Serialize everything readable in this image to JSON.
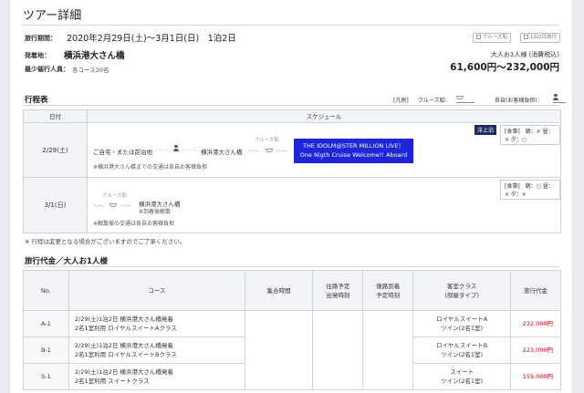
{
  "header": {
    "title": "ツアー詳細"
  },
  "info": {
    "period_label": "旅行期間：",
    "period_value": "2020年2月29日(土)〜3月1日(日)　1泊2日",
    "depart_label": "発着地：",
    "depart_value": "横浜港大さん橋",
    "min_label": "最少催行人員：",
    "min_value": "各コース20名",
    "cruise_chip": "クルーズ船",
    "nights_chip": "1泊2日旅行",
    "price_note": "大人お1人様 (消費税込)",
    "price_range": "61,600円〜232,000円"
  },
  "itinerary": {
    "section_title": "行程表",
    "legend_label": "[凡例]",
    "legend_ship": "クルーズ船：",
    "legend_own": "各自(お客様負担)：",
    "col_date": "日付",
    "col_schedule": "スケジュール",
    "days": [
      {
        "date": "2/29(土)",
        "onboard": "洋上泊",
        "meals": "[食事]　朝：× 昼：× 夕：○",
        "home": "ご自宅・または前泊地",
        "port": "横浜港大さん橋",
        "ship_label": "クルーズ船",
        "event_line1": "THE IDOLM@STER MILLION LIVE！",
        "event_line2": "One Nigth Cruise Welcome!! Aboard",
        "note": "※横浜港大さん橋までの交通は各自お客様負担"
      },
      {
        "date": "3/1(日)",
        "meals": "[食事]　朝：○ 昼：× 夕：×",
        "ship_label": "クルーズ船",
        "port": "横浜港大さん橋",
        "arrive_note": "※到着後解散",
        "note": "※解散後の交通は各自お客様負担"
      }
    ],
    "footnote": "※ 行程は変更となる場合がございますのでご了承ください。"
  },
  "pricing": {
    "section_title": "旅行代金／大人お1人様",
    "headers": {
      "no": "No.",
      "course": "コース",
      "meet": "集合時間",
      "out_line1": "往路予定",
      "out_line2": "出発時刻",
      "ret_line1": "復路到着",
      "ret_line2": "予定時刻",
      "room_line1": "客室クラス",
      "room_line2": "(部屋タイプ)",
      "price": "旅行代金"
    },
    "rows": [
      {
        "no": "A-1",
        "course_line1": "2/29(土)1泊2日 横浜港大さん橋発着",
        "course_line2": "2名1室利用 ロイヤルスイートAクラス",
        "room_line1": "ロイヤルスイートA",
        "room_line2": "ツイン(2名1室)",
        "price": "232,000円"
      },
      {
        "no": "B-1",
        "course_line1": "2/29(土)1泊2日 横浜港大さん橋発着",
        "course_line2": "2名1室利用 ロイヤルスイートBクラス",
        "room_line1": "ロイヤルスイートB",
        "room_line2": "ツイン(2名1室)",
        "price": "223,000円"
      },
      {
        "no": "S-1",
        "course_line1": "2/29(土)1泊2日 横浜港大さん橋発着",
        "course_line2": "2名1室利用 スイートクラス",
        "room_line1": "スイート",
        "room_line2": "ツイン(2名1室)",
        "price": "159,000円"
      }
    ]
  },
  "colors": {
    "event_bg": "#1f25d8",
    "onboard_bg": "#1d2b5f",
    "price_red": "#d0021b"
  }
}
